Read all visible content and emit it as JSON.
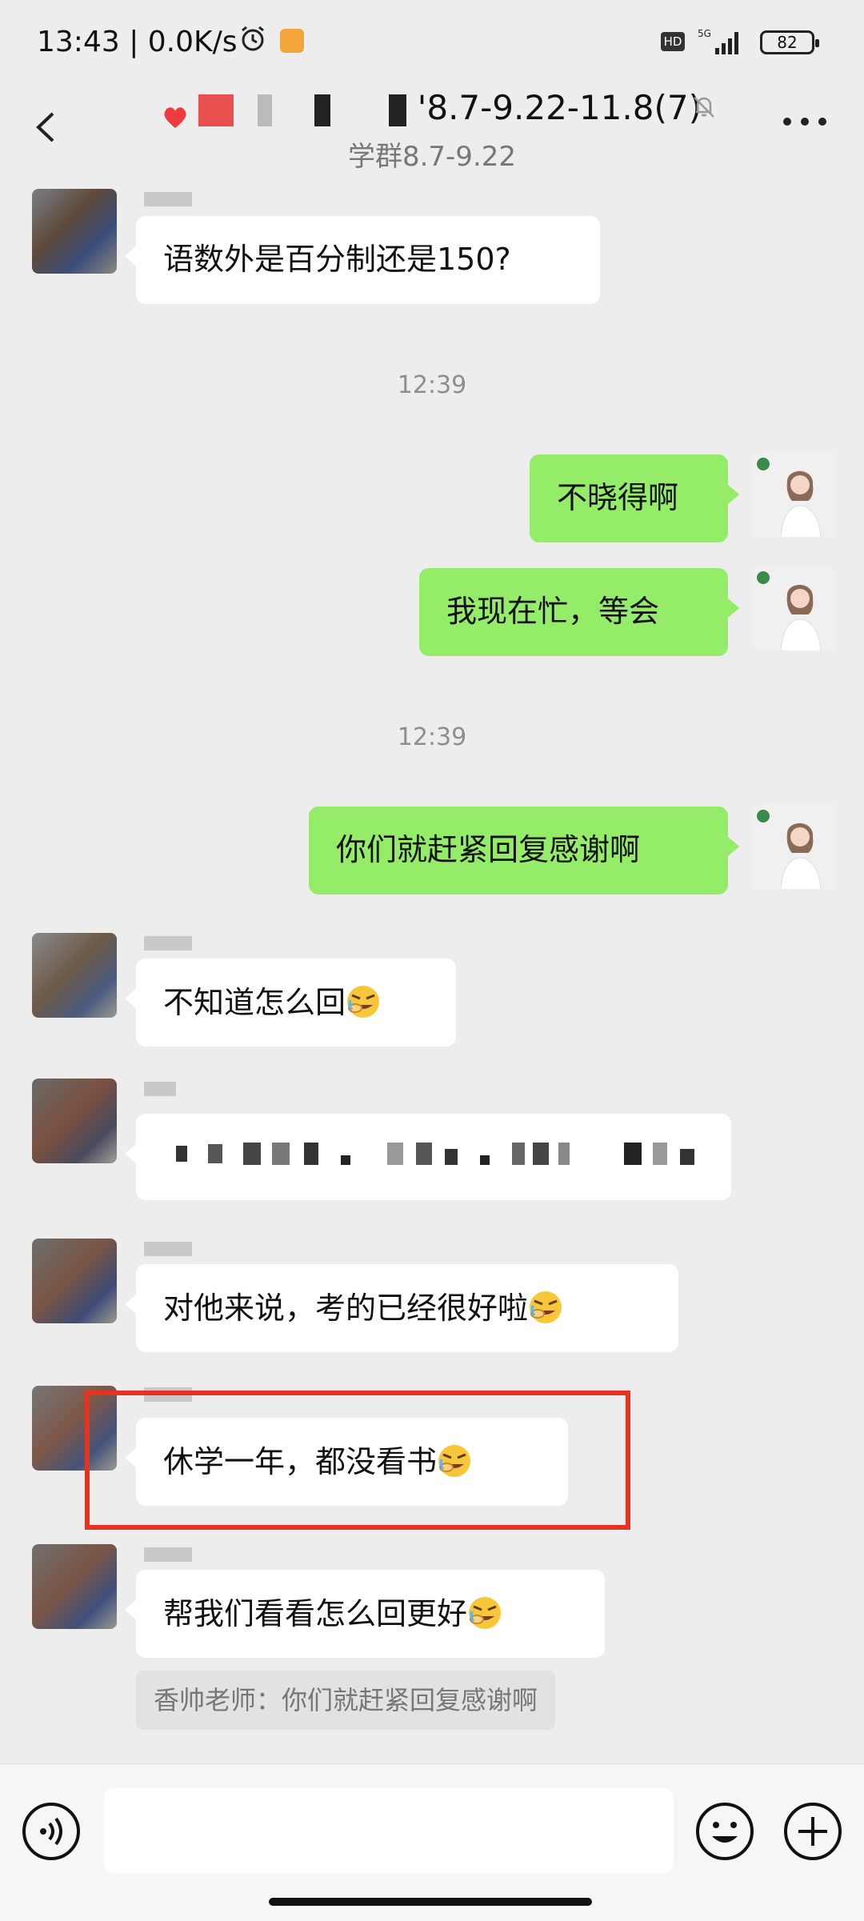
{
  "status_bar": {
    "time": "13:43 | 0.0K/s",
    "hd": "HD",
    "network": "5G",
    "battery": "82"
  },
  "header": {
    "title": "'8.7-9.22-11.8(7)",
    "subtitle": "学群8.7-9.22"
  },
  "messages": [
    {
      "side": "left",
      "text": "语数外是百分制还是150?"
    },
    {
      "timestamp": "12:39"
    },
    {
      "side": "right",
      "text": "不晓得啊"
    },
    {
      "side": "right",
      "text": "我现在忙，等会"
    },
    {
      "timestamp": "12:39"
    },
    {
      "side": "right",
      "text": "你们就赶紧回复感谢啊"
    },
    {
      "side": "left",
      "text": "不知道怎么回",
      "emoji": "facepalm-laugh-emoji"
    },
    {
      "side": "left",
      "text": "",
      "redacted": true
    },
    {
      "side": "left",
      "text": "对他来说，考的已经很好啦",
      "emoji": "facepalm-laugh-emoji"
    },
    {
      "side": "left",
      "text": "休学一年，都没看书",
      "emoji": "facepalm-laugh-emoji",
      "highlighted": true
    },
    {
      "side": "left",
      "text": "帮我们看看怎么回更好",
      "emoji": "facepalm-laugh-emoji"
    }
  ],
  "quote": {
    "text": "香帅老师：你们就赶紧回复感谢啊"
  },
  "colors": {
    "bubble_right": "#95ec69",
    "bubble_left": "#ffffff",
    "highlight": "#e53221",
    "background": "#ededed"
  },
  "icons": [
    "back-icon",
    "mute-icon",
    "more-icon",
    "voice-icon",
    "emoji-icon",
    "plus-icon"
  ]
}
